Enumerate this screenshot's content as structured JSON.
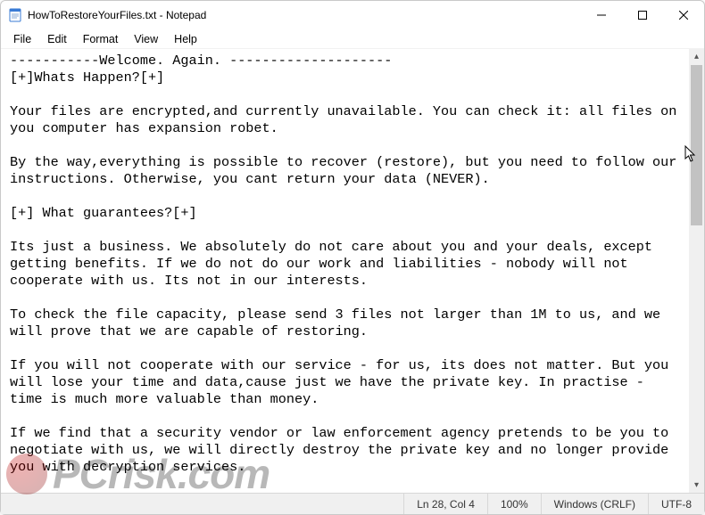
{
  "titlebar": {
    "title": "HowToRestoreYourFiles.txt - Notepad"
  },
  "menu": {
    "items": [
      "File",
      "Edit",
      "Format",
      "View",
      "Help"
    ]
  },
  "document": {
    "text": "-----------Welcome. Again. --------------------\n[+]Whats Happen?[+]\n\nYour files are encrypted,and currently unavailable. You can check it: all files on you computer has expansion robet.\n\nBy the way,everything is possible to recover (restore), but you need to follow our instructions. Otherwise, you cant return your data (NEVER).\n\n[+] What guarantees?[+]\n\nIts just a business. We absolutely do not care about you and your deals, except getting benefits. If we do not do our work and liabilities - nobody will not cooperate with us. Its not in our interests.\n\nTo check the file capacity, please send 3 files not larger than 1M to us, and we will prove that we are capable of restoring.\n\nIf you will not cooperate with our service - for us, its does not matter. But you will lose your time and data,cause just we have the private key. In practise - time is much more valuable than money.\n\nIf we find that a security vendor or law enforcement agency pretends to be you to negotiate with us, we will directly destroy the private key and no longer provide you with decryption services."
  },
  "statusbar": {
    "caret": "Ln 28, Col 4",
    "zoom": "100%",
    "eol": "Windows (CRLF)",
    "encoding": "UTF-8"
  },
  "watermark": {
    "text": "PCrisk.com"
  }
}
